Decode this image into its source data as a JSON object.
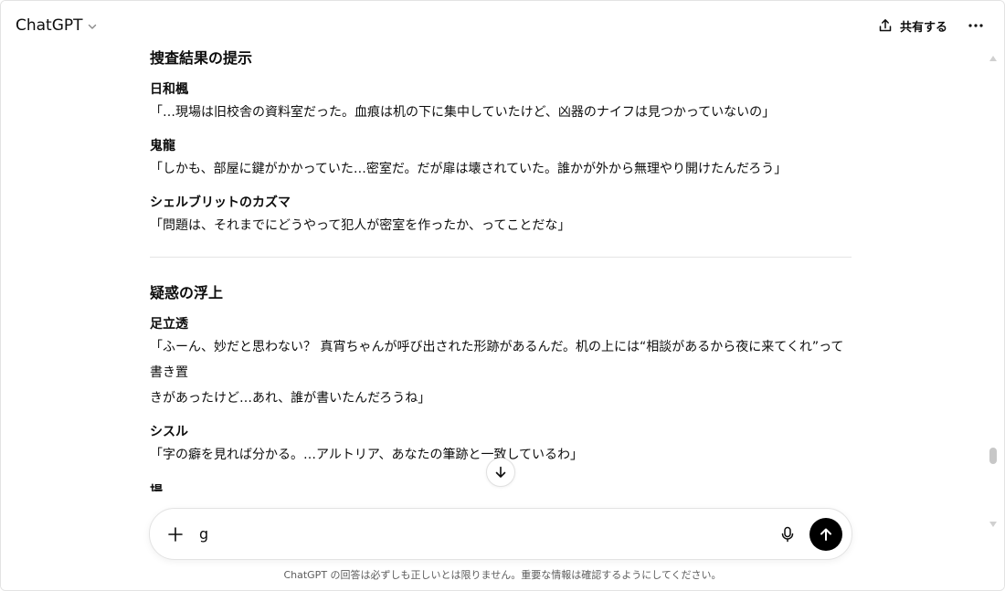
{
  "header": {
    "model_name": "ChatGPT",
    "share_label": "共有する"
  },
  "conversation": {
    "sections": [
      {
        "title": "捜査結果の提示",
        "entries": [
          {
            "speaker": "日和楓",
            "lines": [
              "「…現場は旧校舎の資料室だった。血痕は机の下に集中していたけど、凶器のナイフは見つかっていないの」"
            ]
          },
          {
            "speaker": "鬼龍",
            "lines": [
              "「しかも、部屋に鍵がかかっていた…密室だ。だが扉は壊されていた。誰かが外から無理やり開けたんだろう」"
            ]
          },
          {
            "speaker": "シェルブリットのカズマ",
            "lines": [
              "「問題は、それまでにどうやって犯人が密室を作ったか、ってことだな」"
            ]
          }
        ]
      },
      {
        "title": "疑惑の浮上",
        "entries": [
          {
            "speaker": "足立透",
            "lines": [
              "「ふーん、妙だと思わない？ 真宵ちゃんが呼び出された形跡があるんだ。机の上には“相談があるから夜に来てくれ”って書き置",
              "きがあったけど…あれ、誰が書いたんだろうね」"
            ]
          },
          {
            "speaker": "シスル",
            "lines": [
              "「字の癖を見れば分かる。…アルトリア、あなたの筆跡と一致しているわ」"
            ]
          }
        ]
      }
    ],
    "partial_next": "場"
  },
  "composer": {
    "value": "g"
  },
  "disclaimer": "ChatGPT の回答は必ずしも正しいとは限りません。重要な情報は確認するようにしてください。",
  "icons": {
    "model_picker": "chevron-down-icon",
    "share": "share-icon",
    "more": "more-horizontal-icon",
    "scroll_down": "arrow-down-icon",
    "attach": "plus-icon",
    "voice": "microphone-icon",
    "send": "arrow-up-icon"
  }
}
